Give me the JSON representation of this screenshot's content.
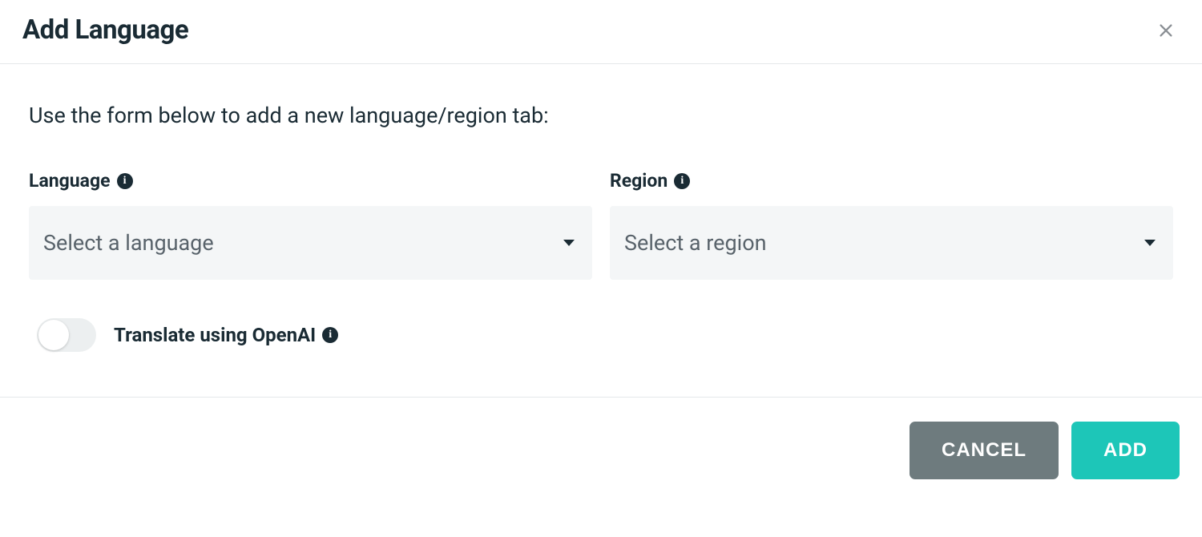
{
  "header": {
    "title": "Add Language"
  },
  "body": {
    "instruction": "Use the form below to add a new language/region tab:",
    "form": {
      "language": {
        "label": "Language",
        "placeholder": "Select a language"
      },
      "region": {
        "label": "Region",
        "placeholder": "Select a region"
      }
    },
    "toggle": {
      "label": "Translate using OpenAI",
      "enabled": false
    }
  },
  "footer": {
    "cancel_label": "CANCEL",
    "add_label": "ADD"
  }
}
